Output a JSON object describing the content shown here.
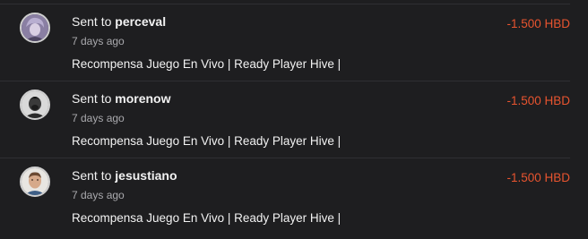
{
  "transactions": [
    {
      "prefix": "Sent to",
      "user": "perceval",
      "time": "7 days ago",
      "memo": "Recompensa Juego En Vivo | Ready Player Hive |",
      "amount": "-1.500 HBD"
    },
    {
      "prefix": "Sent to",
      "user": "morenow",
      "time": "7 days ago",
      "memo": "Recompensa Juego En Vivo | Ready Player Hive |",
      "amount": "-1.500 HBD"
    },
    {
      "prefix": "Sent to",
      "user": "jesustiano",
      "time": "7 days ago",
      "memo": "Recompensa Juego En Vivo | Ready Player Hive |",
      "amount": "-1.500 HBD"
    }
  ],
  "colors": {
    "background": "#1e1e20",
    "divider": "#2f2f33",
    "amount_negative": "#e8542f",
    "secondary_text": "#a9a9ad"
  }
}
